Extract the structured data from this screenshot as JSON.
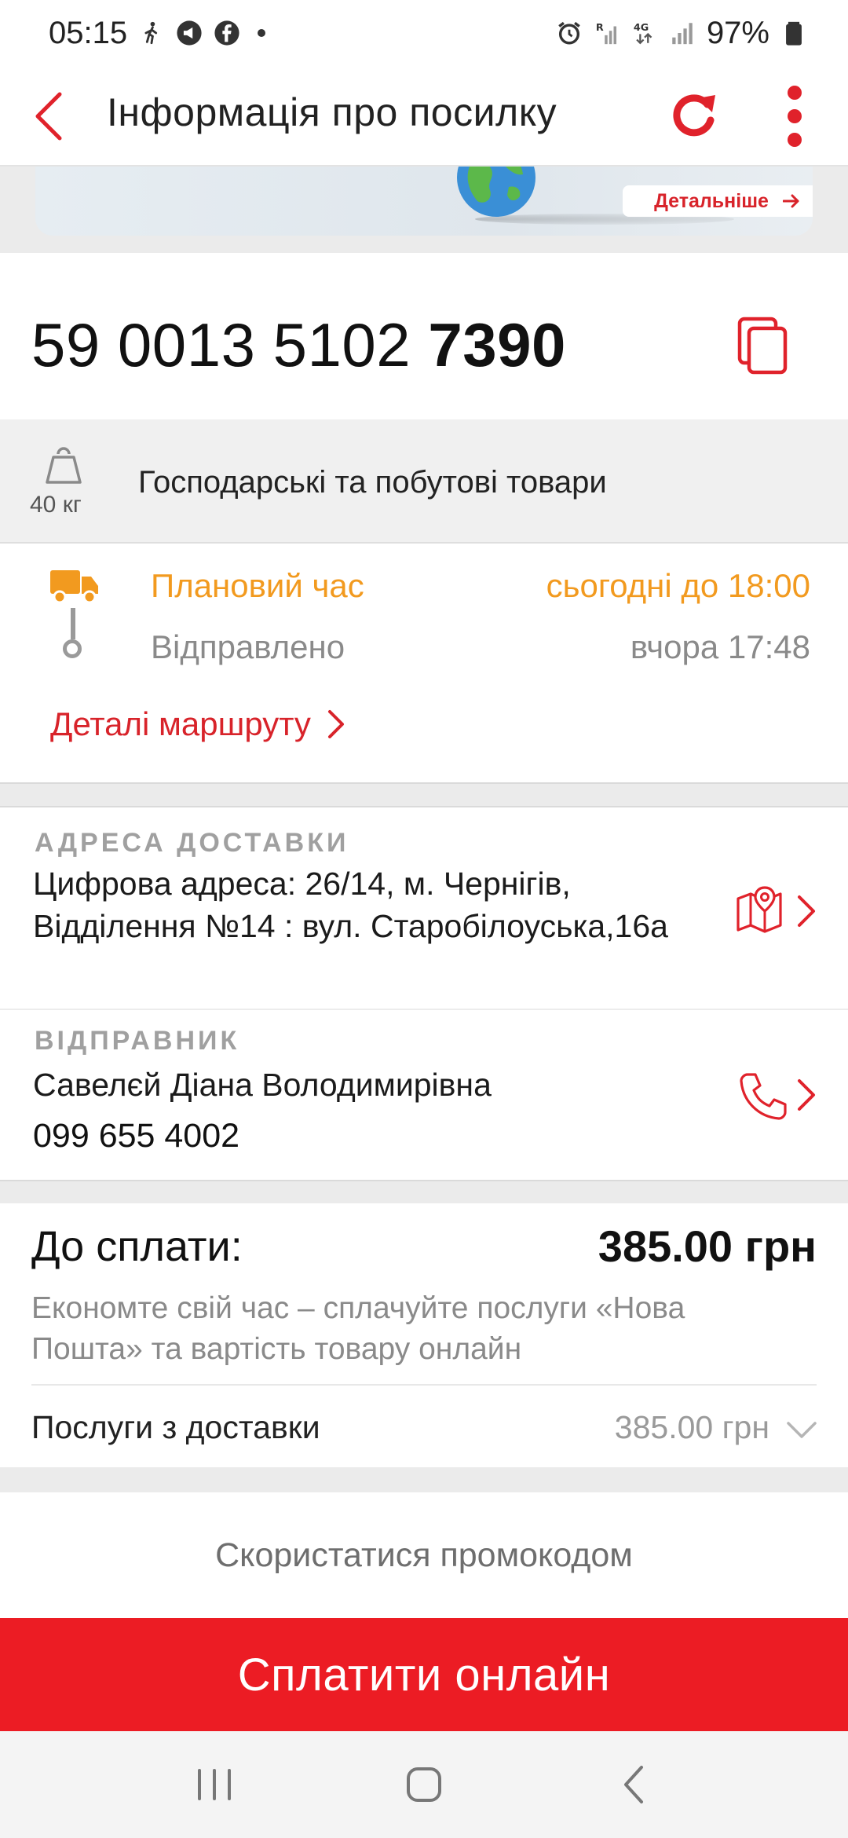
{
  "status_bar": {
    "time": "05:15",
    "battery": "97%",
    "network": "4G"
  },
  "app_bar": {
    "title": "Інформація про посилку"
  },
  "banner": {
    "button_label": "Детальніше"
  },
  "parcel": {
    "tracking_prefix": "59 0013 5102",
    "tracking_suffix": "7390",
    "weight": "40 кг",
    "description": "Господарські та побутові товари"
  },
  "delivery_status": {
    "planned_label": "Плановий час",
    "planned_value": "сьогодні до 18:00",
    "sent_label": "Відправлено",
    "sent_value": "вчора 17:48",
    "route_link": "Деталі маршруту"
  },
  "address": {
    "label": "АДРЕСА ДОСТАВКИ",
    "text": "Цифрова адреса: 26/14, м. Чернігів, Відділення №14 : вул. Старобілоуська,16а"
  },
  "sender": {
    "label": "ВІДПРАВНИК",
    "name": "Савелєй Діана Володимирівна",
    "phone": "099 655 4002"
  },
  "payment": {
    "label": "До сплати:",
    "amount": "385.00 грн",
    "note": "Економте свій час – сплачуйте послуги «Нова Пошта» та вартість товару онлайн",
    "services_label": "Послуги з доставки",
    "services_value": "385.00 грн"
  },
  "promo": {
    "label": "Скористатися промокодом"
  },
  "pay_button": {
    "label": "Сплатити онлайн"
  },
  "colors": {
    "accent_red": "#ec1c24",
    "link_red": "#d8232a",
    "orange": "#f29a1f",
    "muted_gray": "#8a8a8a"
  }
}
